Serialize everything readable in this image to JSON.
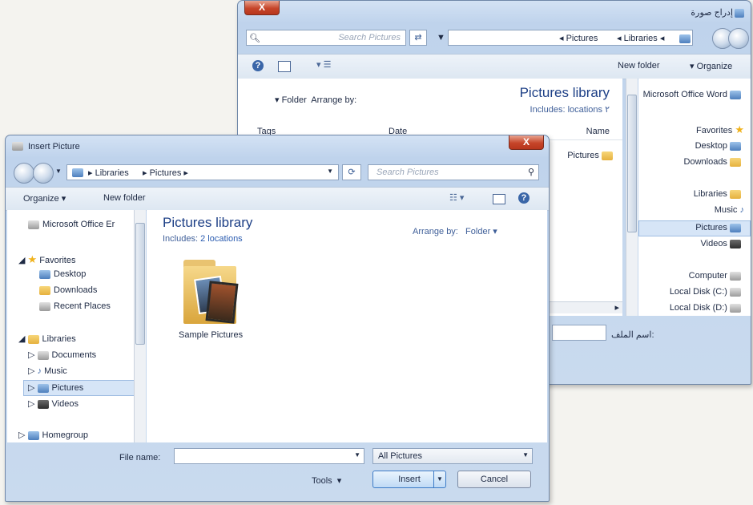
{
  "back_window": {
    "title": "إدراج صورة",
    "breadcrumb": [
      "Pictures",
      "Libraries"
    ],
    "search_placeholder": "Search Pictures",
    "toolbar": {
      "new_folder": "New folder",
      "organize": "Organize"
    },
    "library_title": "Pictures library",
    "includes": "Includes:  locations ٢",
    "arrange_by": "Arrange by:",
    "arrange_value": "Folder",
    "columns": {
      "name": "Name",
      "date": "Date",
      "tags": "Tags"
    },
    "file_item": "Pictures",
    "filename_label": "اسم الملف:",
    "nav": {
      "msword": "Microsoft Office Word",
      "favorites": "Favorites",
      "items": [
        "Desktop",
        "Downloads"
      ],
      "libraries": "Libraries",
      "lib_items": [
        "Music",
        "Pictures",
        "Videos"
      ],
      "computer": "Computer",
      "disks": [
        "Local Disk (C:)",
        "Local Disk (D:)"
      ]
    }
  },
  "front_window": {
    "title": "Insert Picture",
    "breadcrumb": [
      "Libraries",
      "Pictures"
    ],
    "search_placeholder": "Search Pictures",
    "toolbar": {
      "organize": "Organize",
      "new_folder": "New folder"
    },
    "library_title": "Pictures library",
    "includes": "Includes:",
    "includes_link": "2 locations",
    "arrange_by": "Arrange by:",
    "arrange_value": "Folder",
    "folder_item": "Sample Pictures",
    "nav": {
      "msword": "Microsoft Office Er",
      "favorites": "Favorites",
      "fav_items": [
        "Desktop",
        "Downloads",
        "Recent Places"
      ],
      "libraries": "Libraries",
      "lib_items": [
        "Documents",
        "Music",
        "Pictures",
        "Videos"
      ],
      "homegroup": "Homegroup"
    },
    "file_name_label": "File name:",
    "file_name_value": "",
    "filter": "All Pictures",
    "tools": "Tools",
    "insert": "Insert",
    "cancel": "Cancel"
  }
}
